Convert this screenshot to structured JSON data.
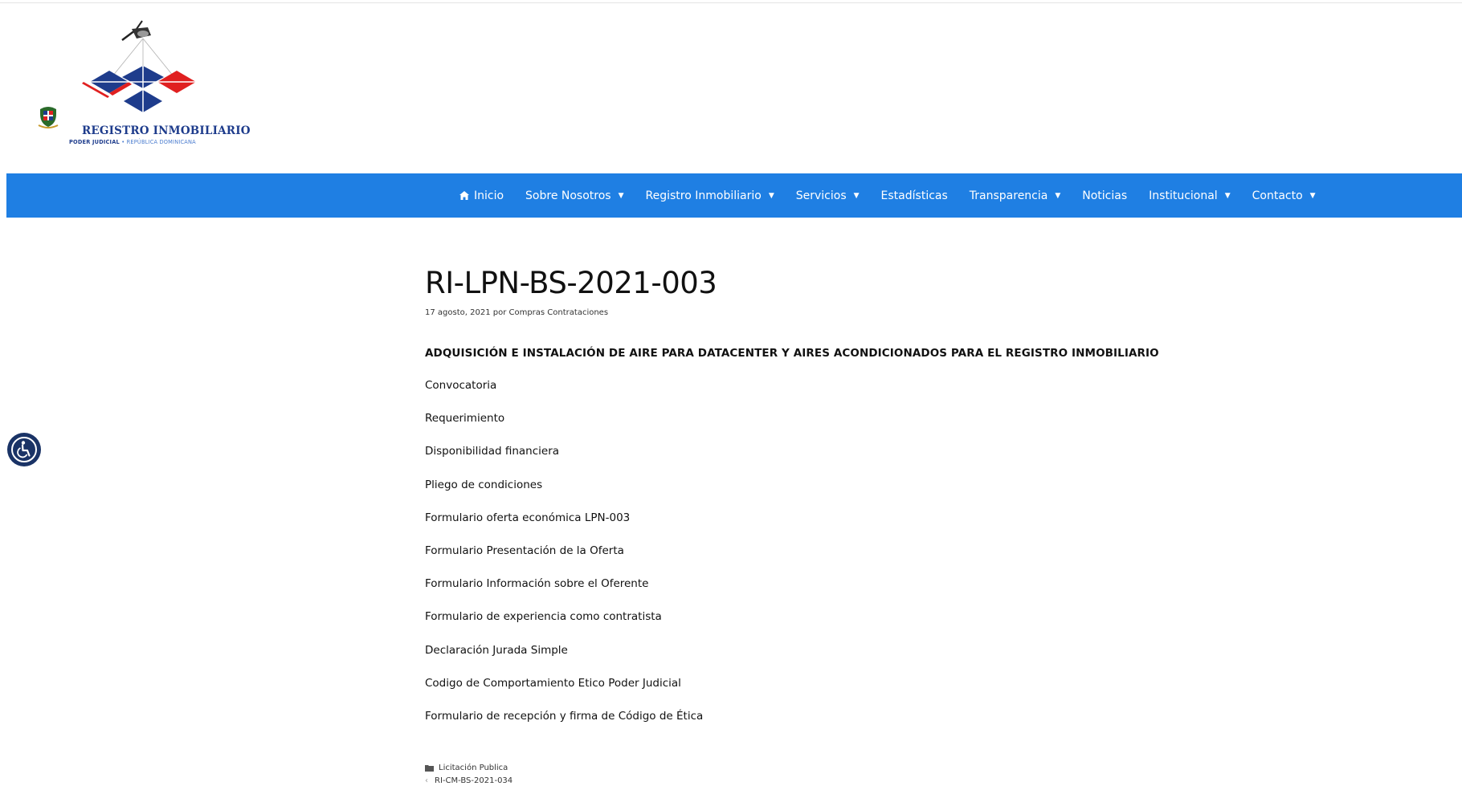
{
  "logo": {
    "title": "REGISTRO INMOBILIARIO",
    "subtitle_org": "PODER JUDICIAL",
    "subtitle_country": " • REPÚBLICA DOMINICANA"
  },
  "nav": {
    "items": [
      {
        "label": "Inicio",
        "icon": "home-icon",
        "has_dropdown": false
      },
      {
        "label": "Sobre Nosotros",
        "has_dropdown": true
      },
      {
        "label": "Registro Inmobiliario",
        "has_dropdown": true
      },
      {
        "label": "Servicios",
        "has_dropdown": true
      },
      {
        "label": "Estadísticas",
        "has_dropdown": false
      },
      {
        "label": "Transparencia",
        "has_dropdown": true
      },
      {
        "label": "Noticias",
        "has_dropdown": false
      },
      {
        "label": "Institucional",
        "has_dropdown": true
      },
      {
        "label": "Contacto",
        "has_dropdown": true
      }
    ],
    "caret": "▼"
  },
  "post": {
    "title": "RI-LPN-BS-2021-003",
    "meta": "17 agosto, 2021 por Compras Contrataciones",
    "heading": "ADQUISICIÓN E INSTALACIÓN DE AIRE PARA DATACENTER Y AIRES ACONDICIONADOS PARA EL REGISTRO INMOBILIARIO",
    "documents": [
      "Convocatoria",
      "Requerimiento",
      "Disponibilidad financiera",
      "Pliego de condiciones",
      "Formulario oferta económica LPN-003",
      "Formulario Presentación de la Oferta",
      "Formulario Información sobre el Oferente",
      "Formulario de experiencia como contratista",
      "Declaración Jurada Simple",
      "Codigo de Comportamiento Etico Poder Judicial",
      "Formulario de recepción y firma de Código de Ética"
    ],
    "category": "Licitación Publica",
    "previous_post": "RI-CM-BS-2021-034",
    "previous_arrow": "‹"
  },
  "colors": {
    "nav_background": "#1f7fe3",
    "logo_blue": "#1e3c8c",
    "logo_red": "#e02020",
    "accessibility_button": "#1a3366"
  }
}
